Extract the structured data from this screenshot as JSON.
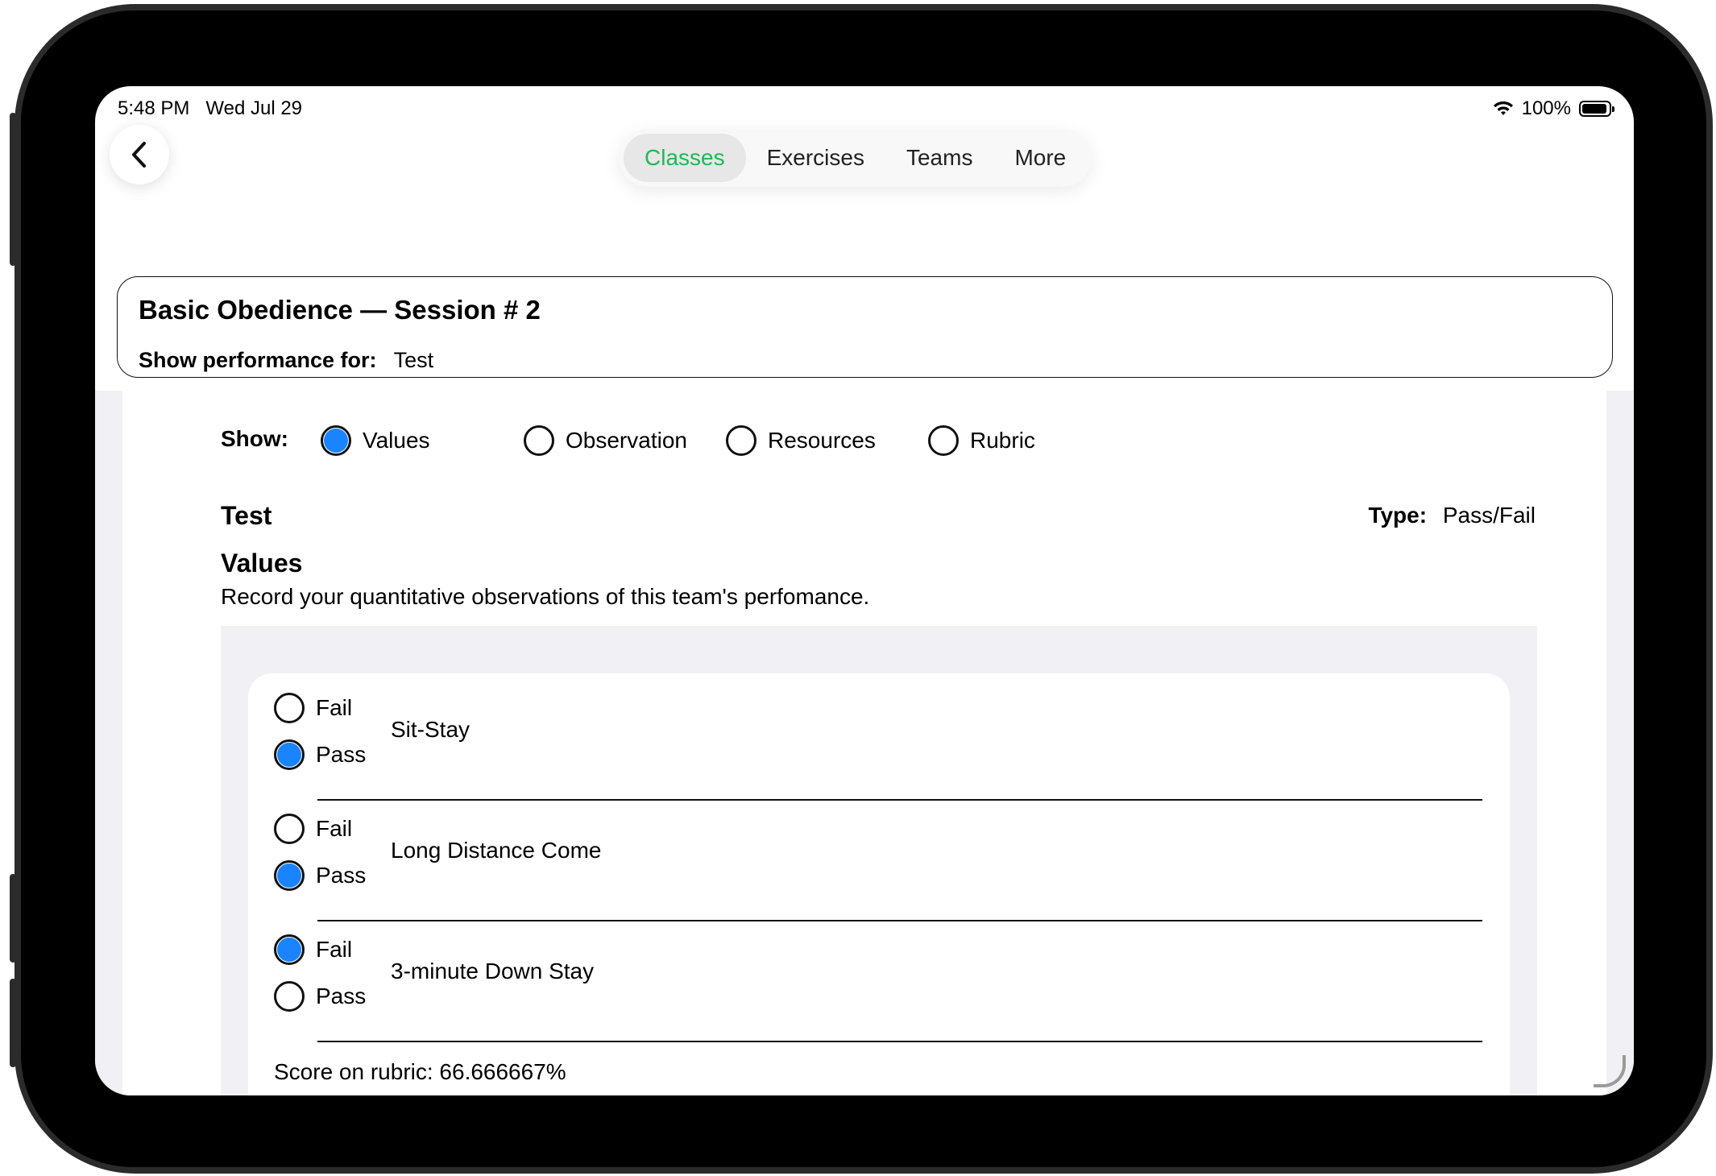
{
  "status_bar": {
    "time": "5:48 PM",
    "date": "Wed Jul 29",
    "battery": "100%"
  },
  "nav": {
    "tabs": [
      {
        "label": "Classes",
        "active": true
      },
      {
        "label": "Exercises",
        "active": false
      },
      {
        "label": "Teams",
        "active": false
      },
      {
        "label": "More",
        "active": false
      }
    ]
  },
  "header": {
    "title": "Basic Obedience — Session # 2",
    "performance_label": "Show performance for:",
    "performance_value": "Test"
  },
  "show": {
    "label": "Show:",
    "options": [
      {
        "label": "Values",
        "selected": true
      },
      {
        "label": "Observation",
        "selected": false
      },
      {
        "label": "Resources",
        "selected": false
      },
      {
        "label": "Rubric",
        "selected": false
      }
    ]
  },
  "exercise": {
    "name": "Test",
    "type_label": "Type:",
    "type_value": "Pass/Fail"
  },
  "values_section": {
    "heading": "Values",
    "description": "Record your quantitative observations of this team's perfomance."
  },
  "items": [
    {
      "name": "Sit-Stay",
      "fail_label": "Fail",
      "pass_label": "Pass",
      "selected": "Pass"
    },
    {
      "name": "Long Distance Come",
      "fail_label": "Fail",
      "pass_label": "Pass",
      "selected": "Pass"
    },
    {
      "name": "3-minute Down Stay",
      "fail_label": "Fail",
      "pass_label": "Pass",
      "selected": "Fail"
    }
  ],
  "score": "Score on rubric: 66.666667%",
  "colors": {
    "accent_green": "#1db954",
    "radio_blue": "#1a84ff",
    "panel_gray": "#f1f1f5"
  }
}
